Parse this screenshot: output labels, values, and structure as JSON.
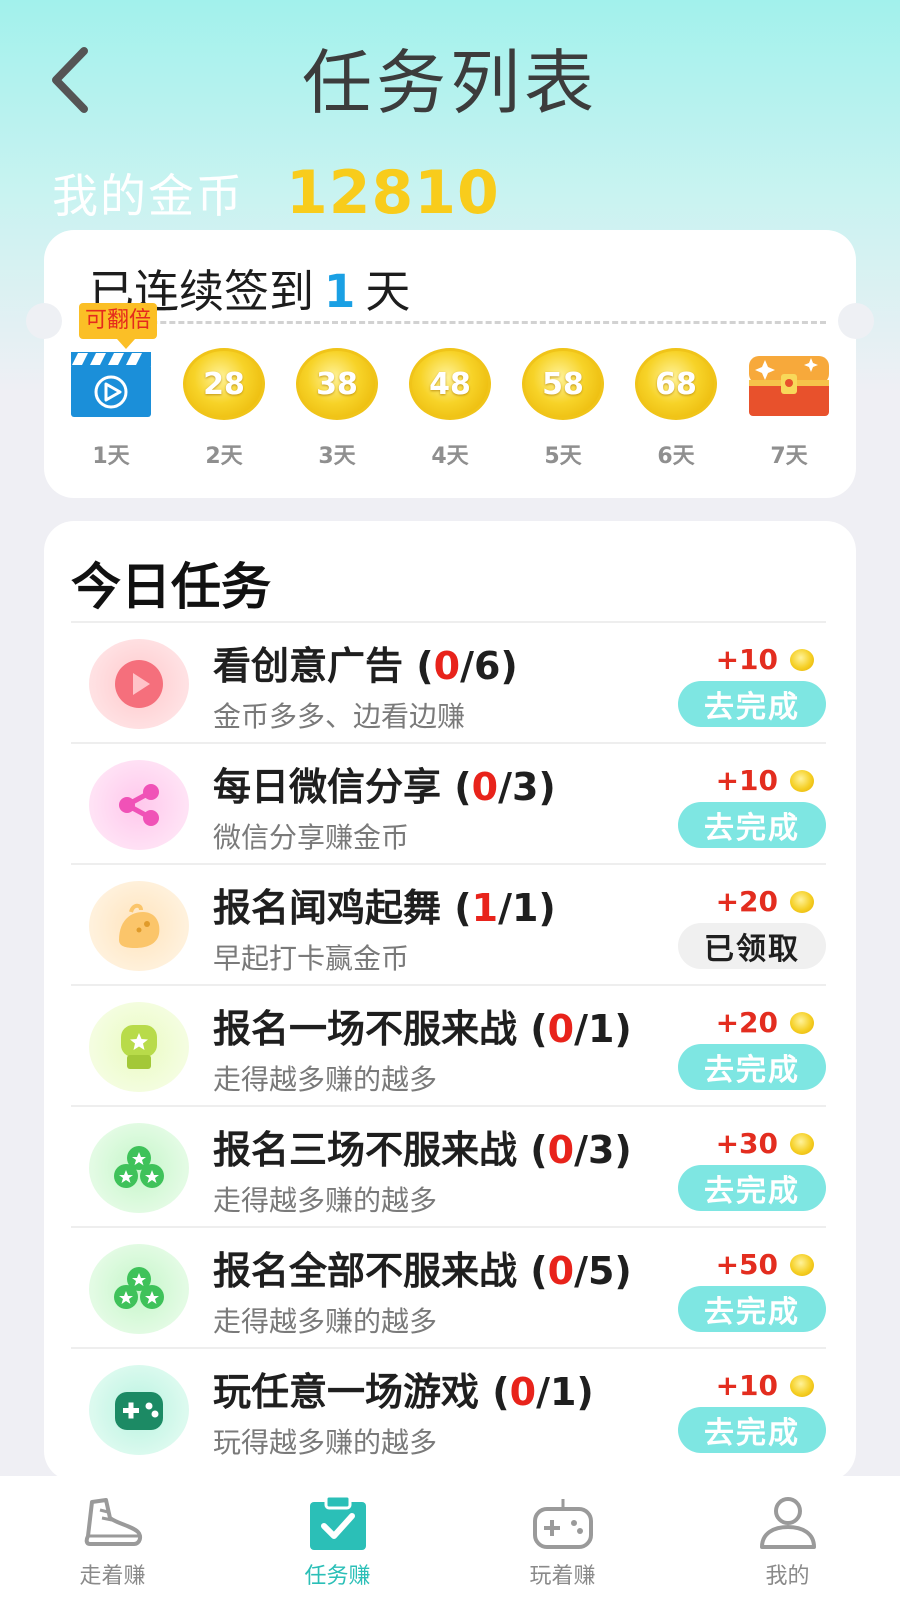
{
  "header": {
    "title": "任务列表",
    "back_icon": "chevron-left-icon"
  },
  "coins": {
    "label": "我的金币",
    "value": "12810"
  },
  "signin": {
    "prefix": "已连续签到",
    "days_count": "1",
    "suffix": "天",
    "double_tag": "可翻倍",
    "days": [
      {
        "label": "1天",
        "icon": "video-clapper-icon"
      },
      {
        "label": "2天",
        "coin": "28"
      },
      {
        "label": "3天",
        "coin": "38"
      },
      {
        "label": "4天",
        "coin": "48"
      },
      {
        "label": "5天",
        "coin": "58"
      },
      {
        "label": "6天",
        "coin": "68"
      },
      {
        "label": "7天",
        "icon": "treasure-chest-icon"
      }
    ]
  },
  "tasks": {
    "heading": "今日任务",
    "items": [
      {
        "name": "看创意广告",
        "progress_done": "0",
        "progress_total": "/6",
        "desc": "金币多多、边看边赚",
        "reward": "+10",
        "button": "去完成",
        "icon": "play-icon"
      },
      {
        "name": "每日微信分享",
        "progress_done": "0",
        "progress_total": "/3",
        "desc": "微信分享赚金币",
        "reward": "+10",
        "button": "去完成",
        "icon": "share-icon"
      },
      {
        "name": "报名闻鸡起舞",
        "progress_done": "1",
        "progress_total": "/1",
        "desc": "早起打卡赢金币",
        "reward": "+20",
        "button": "已领取",
        "icon": "chick-icon"
      },
      {
        "name": "报名一场不服来战",
        "progress_done": "0",
        "progress_total": "/1",
        "desc": "走得越多赚的越多",
        "reward": "+20",
        "button": "去完成",
        "icon": "boxing-glove-icon"
      },
      {
        "name": "报名三场不服来战",
        "progress_done": "0",
        "progress_total": "/3",
        "desc": "走得越多赚的越多",
        "reward": "+30",
        "button": "去完成",
        "icon": "three-stars-icon"
      },
      {
        "name": "报名全部不服来战",
        "progress_done": "0",
        "progress_total": "/5",
        "desc": "走得越多赚的越多",
        "reward": "+50",
        "button": "去完成",
        "icon": "three-stars-icon"
      },
      {
        "name": "玩任意一场游戏",
        "progress_done": "0",
        "progress_total": "/1",
        "desc": "玩得越多赚的越多",
        "reward": "+10",
        "button": "去完成",
        "icon": "gamepad-icon"
      }
    ]
  },
  "nav": {
    "items": [
      {
        "label": "走着赚",
        "icon": "sneaker-icon"
      },
      {
        "label": "任务赚",
        "icon": "clipboard-check-icon",
        "active": true
      },
      {
        "label": "玩着赚",
        "icon": "gamepad-icon"
      },
      {
        "label": "我的",
        "icon": "user-icon"
      }
    ]
  },
  "colors": {
    "accent": "#2bbfb7",
    "coin_gold": "#f8cc1c",
    "red": "#e8231b",
    "button_bg": "#7ee6e2",
    "streak_blue": "#1aa0e4"
  }
}
